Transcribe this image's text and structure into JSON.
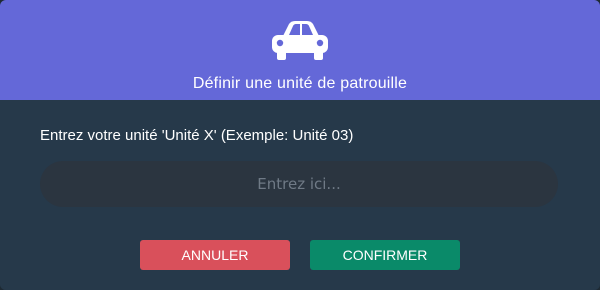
{
  "dialog": {
    "icon": "car-icon",
    "title": "Définir une unité de patrouille",
    "prompt": "Entrez votre unité 'Unité X' (Exemple: Unité 03)",
    "input": {
      "value": "",
      "placeholder": "Entrez ici..."
    },
    "buttons": {
      "cancel_label": "ANNULER",
      "confirm_label": "CONFIRMER"
    }
  },
  "colors": {
    "header": "#6468d8",
    "body": "#26394a",
    "input": "#2b3540",
    "cancel": "#d9505b",
    "confirm": "#0a8a69"
  }
}
